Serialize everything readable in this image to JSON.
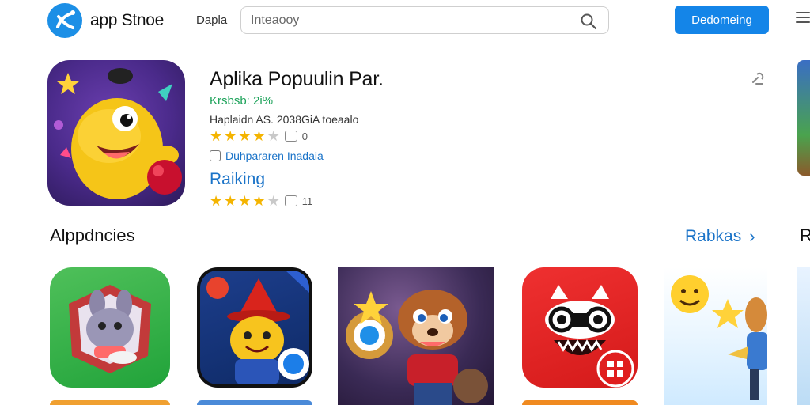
{
  "header": {
    "logo_text": "app Stnoe",
    "nav_link": "Dapla",
    "search_placeholder": "Inteaooy",
    "primary_button": "Dedomeing"
  },
  "featured": {
    "title": "Aplika Popuulin Par.",
    "tagline": "Krsbsb: 2i%",
    "meta": "Haplaidn AS. 2038GiA toeaalo",
    "rating": {
      "stars": 4,
      "max": 5,
      "count": "0"
    },
    "developer": "Duhpararen Inadaia",
    "ranking_label": "Raiking",
    "ranking_rating": {
      "stars": 4,
      "max": 5,
      "count": "11"
    }
  },
  "section": {
    "title": "Alppdncies",
    "see_all": "Rabkas",
    "next_section_initial": "R"
  },
  "tiles": [
    {
      "name": "app-tile-green"
    },
    {
      "name": "app-tile-wizard"
    },
    {
      "name": "app-tile-squirrel"
    },
    {
      "name": "app-tile-red"
    },
    {
      "name": "app-tile-emoji"
    }
  ],
  "colors": {
    "accent": "#1485e8",
    "link": "#1a73c8",
    "tagline_green": "#1ea35b",
    "star": "#f4b400"
  }
}
